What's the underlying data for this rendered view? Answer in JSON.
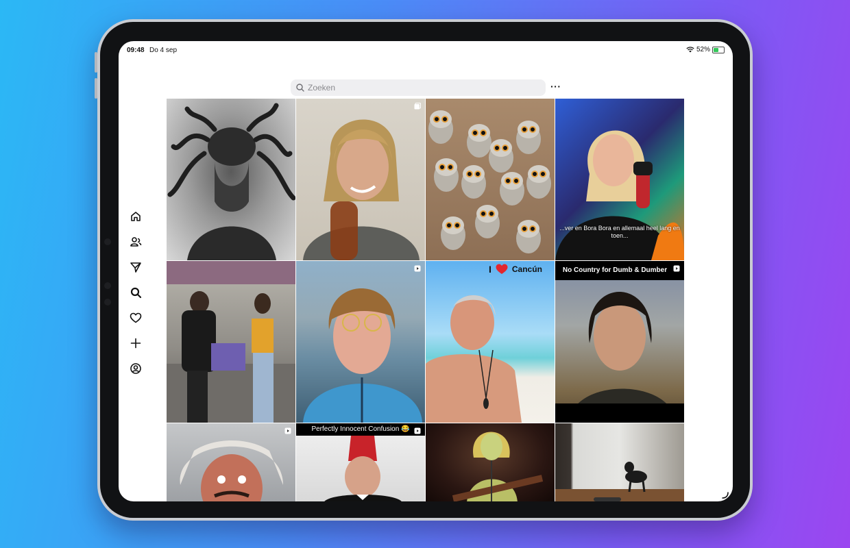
{
  "status_bar": {
    "time": "09:48",
    "date": "Do 4 sep",
    "battery": "52%",
    "battery_level": 0.52
  },
  "search": {
    "placeholder": "Zoeken"
  },
  "header": {
    "more_label": "···"
  },
  "sidebar": {
    "items": [
      {
        "name": "home-icon"
      },
      {
        "name": "people-icon"
      },
      {
        "name": "send-icon"
      },
      {
        "name": "search-icon"
      },
      {
        "name": "heart-icon"
      },
      {
        "name": "plus-icon"
      },
      {
        "name": "profile-icon"
      }
    ]
  },
  "grid": {
    "tiles": [
      {
        "subject": "monochrome artwork of a creature with tentacle hair",
        "badge": "none"
      },
      {
        "subject": "young man with shoulder-length blond hair holding a bottle",
        "badge": "carousel"
      },
      {
        "subject": "group of baby owls",
        "badge": "none"
      },
      {
        "subject": "blonde woman speaking into a podcast microphone",
        "badge": "none",
        "caption": "...ver en Bora Bora en allemaal heel lang en toen..."
      },
      {
        "subject": "people standing in a subway car",
        "badge": "none"
      },
      {
        "subject": "man with bowl haircut and round glasses by the water",
        "badge": "reel"
      },
      {
        "subject": "smiling shirtless man on a beach",
        "badge": "none",
        "caption_prefix": "I",
        "caption_suffix": "Cancún"
      },
      {
        "subject": "man with pageboy haircut smiling",
        "badge": "reel",
        "caption": "No Country for Dumb & Dumber"
      },
      {
        "subject": "old man with wild white hair looking shocked",
        "badge": "reel"
      },
      {
        "subject": "man in red fez and tuxedo",
        "badge": "reel",
        "caption": "Perfectly Innocent Confusion 😂"
      },
      {
        "subject": "woman singing on stage with a guitar",
        "badge": "none"
      },
      {
        "subject": "dog in a room next to a white brick wall",
        "badge": "none"
      }
    ]
  },
  "colors": {
    "accent_green": "#34c759",
    "search_bg": "#efeff1"
  }
}
